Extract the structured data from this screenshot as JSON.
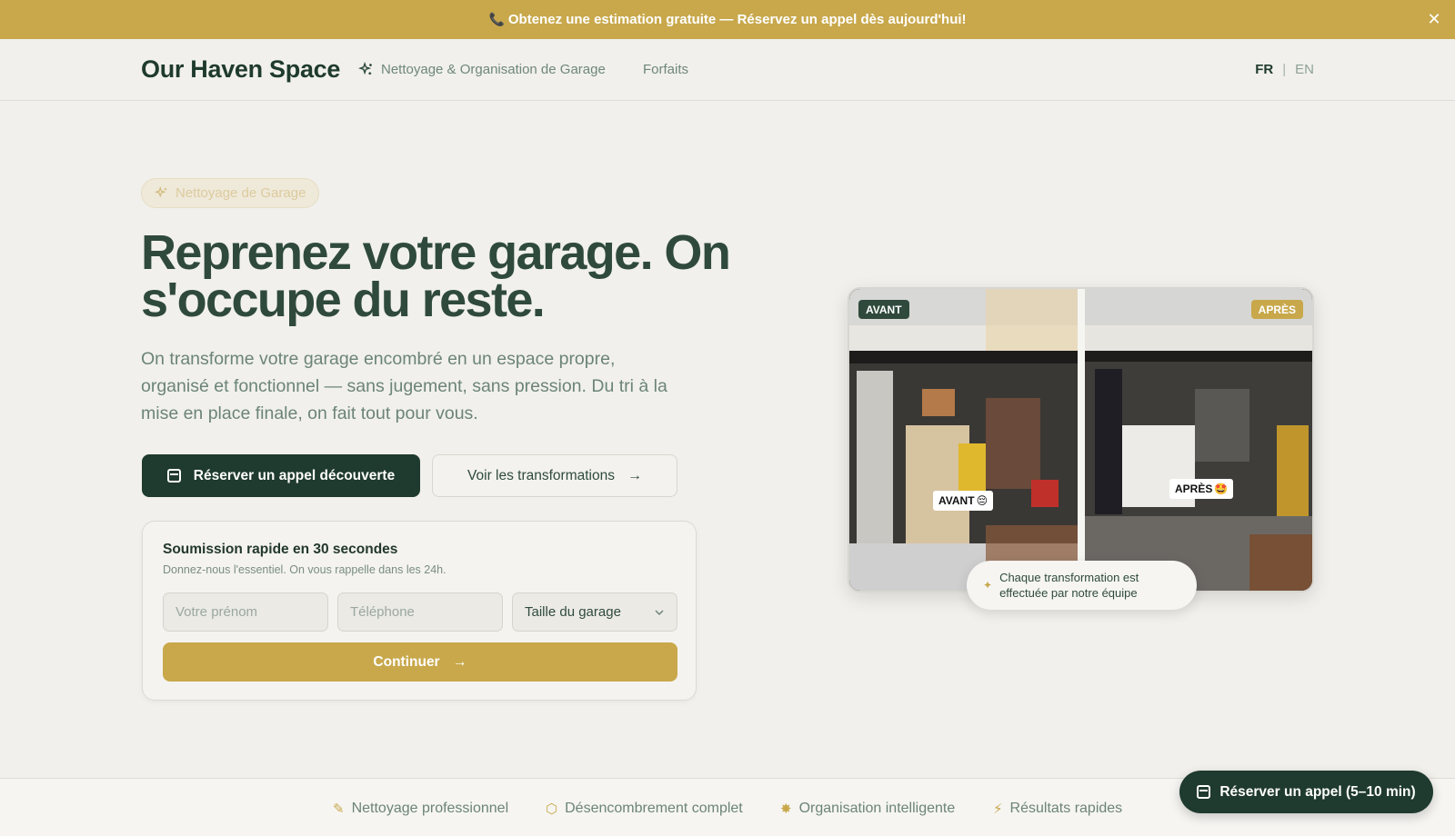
{
  "banner": {
    "text": "Obtenez une estimation gratuite — Réservez un appel dès aujourd'hui!",
    "icon": "phone-icon",
    "close_icon": "close-icon"
  },
  "nav": {
    "logo": "Our Haven Space",
    "links": [
      {
        "label": "Nettoyage & Organisation de Garage",
        "icon": "sparkle-icon"
      },
      {
        "label": "Forfaits"
      }
    ],
    "languages": {
      "active": "FR",
      "separator": "|",
      "other": "EN"
    }
  },
  "hero": {
    "badge": "Nettoyage de Garage",
    "headline": "Reprenez votre garage. On s'occupe du reste.",
    "lead": "On transforme votre garage encombré en un espace propre, organisé et fonctionnel — sans jugement, sans pression. Du tri à la mise en place finale, on fait tout pour vous.",
    "primary_button": "Réserver un appel découverte",
    "secondary_button": "Voir les transformations"
  },
  "quick_form": {
    "title": "Soumission rapide en 30 secondes",
    "subtitle": "Donnez-nous l'essentiel. On vous rappelle dans les 24h.",
    "first_name_placeholder": "Votre prénom",
    "phone_placeholder": "Téléphone",
    "garage_size_selected": "Taille du garage",
    "submit": "Continuer"
  },
  "photo": {
    "before_tag": "AVANT",
    "after_tag": "APRÈS",
    "before_sticker": "AVANT",
    "after_sticker": "APRÈS",
    "caption": "Chaque transformation est effectuée par notre équipe"
  },
  "features": [
    {
      "label": "Nettoyage professionnel",
      "icon": "brush-icon"
    },
    {
      "label": "Désencombrement complet",
      "icon": "box-icon"
    },
    {
      "label": "Organisation intelligente",
      "icon": "organize-icon"
    },
    {
      "label": "Résultats rapides",
      "icon": "bolt-icon"
    }
  ],
  "floating_cta": "Réserver un appel (5–10 min)",
  "colors": {
    "primary": "#1f3a2e",
    "accent": "#c8a84b",
    "background": "#f1f0ec",
    "text": "#2f4a3c"
  }
}
